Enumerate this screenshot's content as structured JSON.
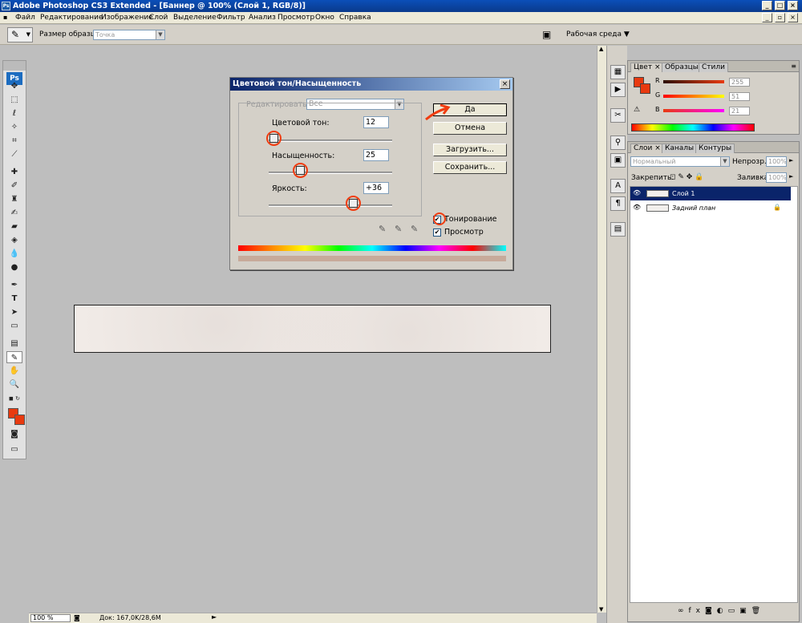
{
  "window": {
    "title": "Adobe Photoshop CS3 Extended - [Баннер @ 100% (Слой 1, RGB/8)]",
    "buttons": [
      "_",
      "□",
      "×"
    ]
  },
  "menu": [
    "Файл",
    "Редактирование",
    "Изображение",
    "Слой",
    "Выделение",
    "Фильтр",
    "Анализ",
    "Просмотр",
    "Окно",
    "Справка"
  ],
  "options": {
    "sample_size_label": "Размер образца:",
    "sample_size_value": "Точка",
    "workspace_label": "Рабочая среда"
  },
  "toolbox": {
    "logo": "Ps",
    "tools": [
      "move",
      "marquee",
      "lasso",
      "magic-wand",
      "crop",
      "slice",
      "healing",
      "brush",
      "stamp",
      "history-brush",
      "eraser",
      "paint-bucket",
      "blur",
      "dodge",
      "pen",
      "type",
      "path-select",
      "shape",
      "notes",
      "eyedropper",
      "hand",
      "zoom"
    ]
  },
  "dialog": {
    "title": "Цветовой тон/Насыщенность",
    "edit_label": "Редактировать:",
    "edit_value": "Все",
    "hue_label": "Цветовой тон:",
    "hue_value": "12",
    "hue_pos": 0.04,
    "saturation_label": "Насыщенность:",
    "saturation_value": "25",
    "saturation_pos": 0.25,
    "lightness_label": "Яркость:",
    "lightness_value": "+36",
    "lightness_pos": 0.68,
    "ok": "Да",
    "cancel": "Отмена",
    "load": "Загрузить...",
    "save": "Сохранить...",
    "colorize": "Тонирование",
    "preview": "Просмотр",
    "colorize_checked": true,
    "preview_checked": true
  },
  "color_panel": {
    "tabs": [
      "Цвет",
      "Образцы",
      "Стили"
    ],
    "r_label": "R",
    "r_value": "255",
    "g_label": "G",
    "g_value": "51",
    "b_label": "B",
    "b_value": "21"
  },
  "layers_panel": {
    "tabs": [
      "Слои",
      "Каналы",
      "Контуры"
    ],
    "blend_mode": "Нормальный",
    "opacity_label": "Непрозр.:",
    "opacity_value": "100%",
    "lock_label": "Закрепить:",
    "fill_label": "Заливка:",
    "fill_value": "100%",
    "layers": [
      {
        "name": "Слой 1",
        "selected": true
      },
      {
        "name": "Задний план",
        "selected": false,
        "locked": true
      }
    ]
  },
  "status": {
    "zoom": "100 %",
    "doc": "Док: 167,0K/28,6M"
  },
  "accent_colors": {
    "foreground": "#e83a10",
    "annotation": "#f03c10",
    "selection": "#0a246a"
  }
}
